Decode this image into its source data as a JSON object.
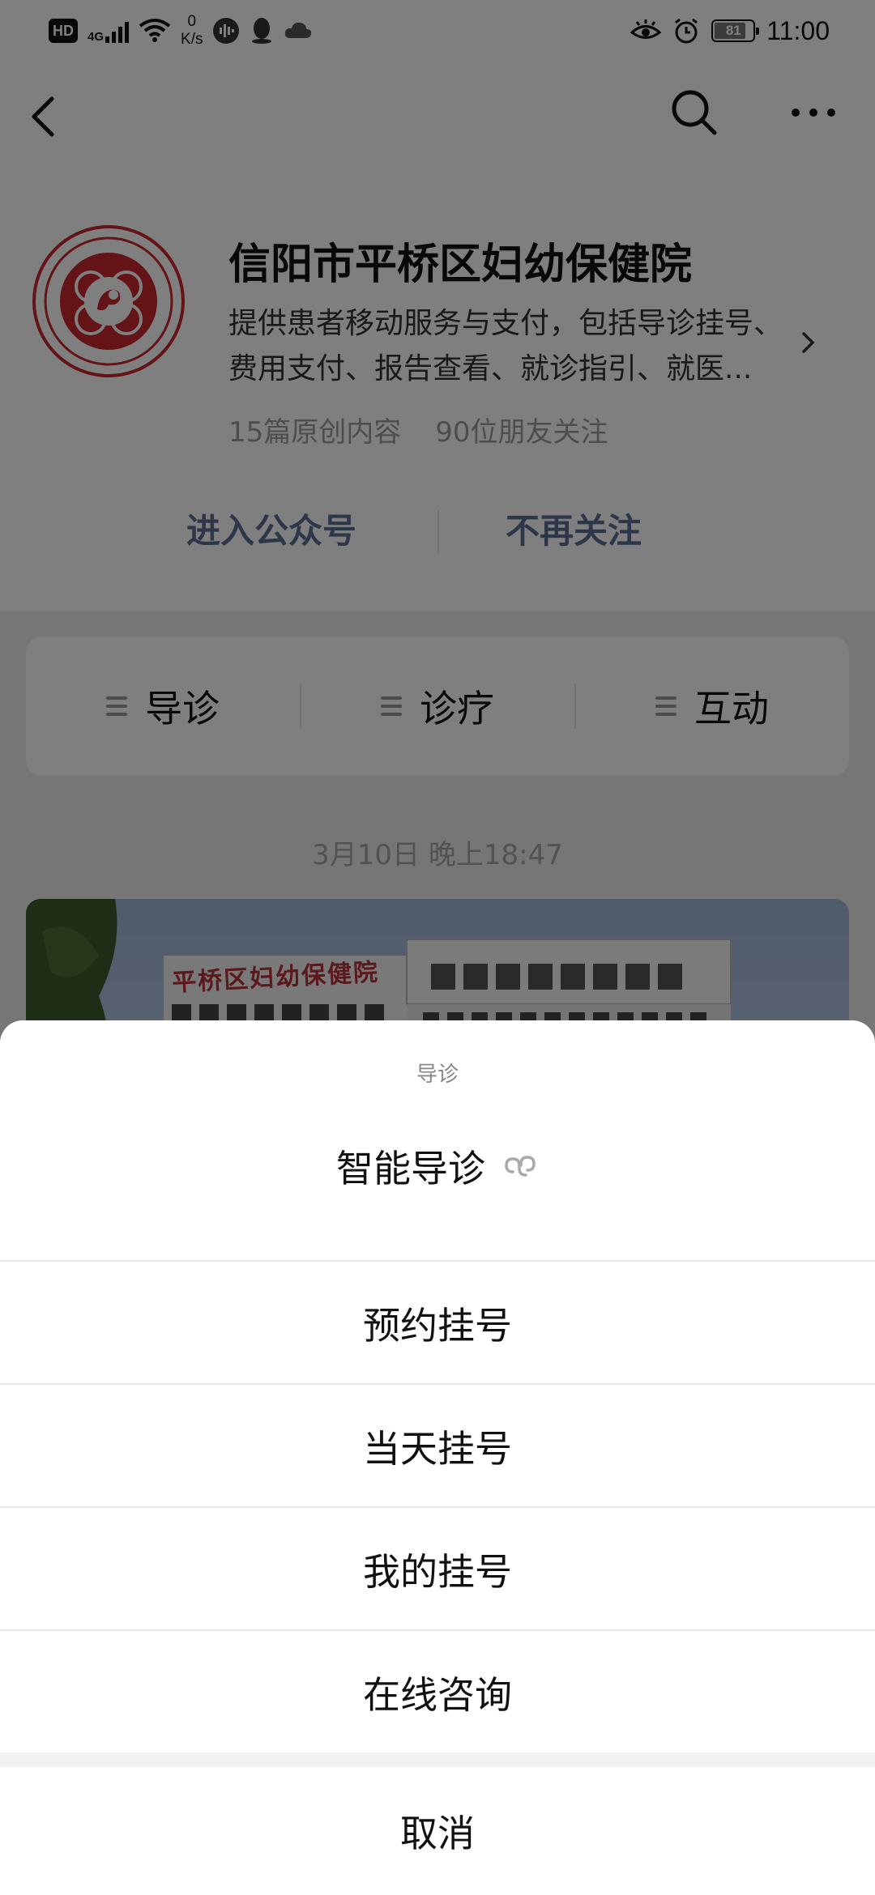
{
  "status_bar": {
    "hd": "HD",
    "net_type": "4G",
    "speed_value": "0",
    "speed_unit": "K/s",
    "battery": "81",
    "battery_level": 0.81,
    "time": "11:00"
  },
  "nav": {
    "back_icon": "back-arrow-icon",
    "search_icon": "search-icon",
    "more_icon": "more-icon"
  },
  "account": {
    "name": "信阳市平桥区妇幼保健院",
    "description": "提供患者移动服务与支付，包括导诊挂号、费用支付、报告查看、就诊指引、就医...",
    "original_count": "15篇原创内容",
    "followers": "90位朋友关注",
    "enter_label": "进入公众号",
    "unfollow_label": "不再关注"
  },
  "menu": {
    "items": [
      {
        "label": "导诊",
        "icon": "menu-list-icon"
      },
      {
        "label": "诊疗",
        "icon": "menu-list-icon"
      },
      {
        "label": "互动",
        "icon": "menu-list-icon"
      }
    ]
  },
  "timestamp": "3月10日 晚上18:47",
  "article": {
    "sign_text": "平桥区妇幼保健院"
  },
  "sheet": {
    "title": "导诊",
    "options": [
      {
        "label": "智能导诊",
        "icon": "mini-program-link-icon"
      },
      {
        "label": "预约挂号"
      },
      {
        "label": "当天挂号"
      },
      {
        "label": "我的挂号"
      },
      {
        "label": "在线咨询"
      }
    ],
    "cancel_label": "取消"
  },
  "colors": {
    "accent_link": "#5b6e92",
    "avatar_red": "#c9262f",
    "overlay": "rgba(0,0,0,0.5)"
  }
}
